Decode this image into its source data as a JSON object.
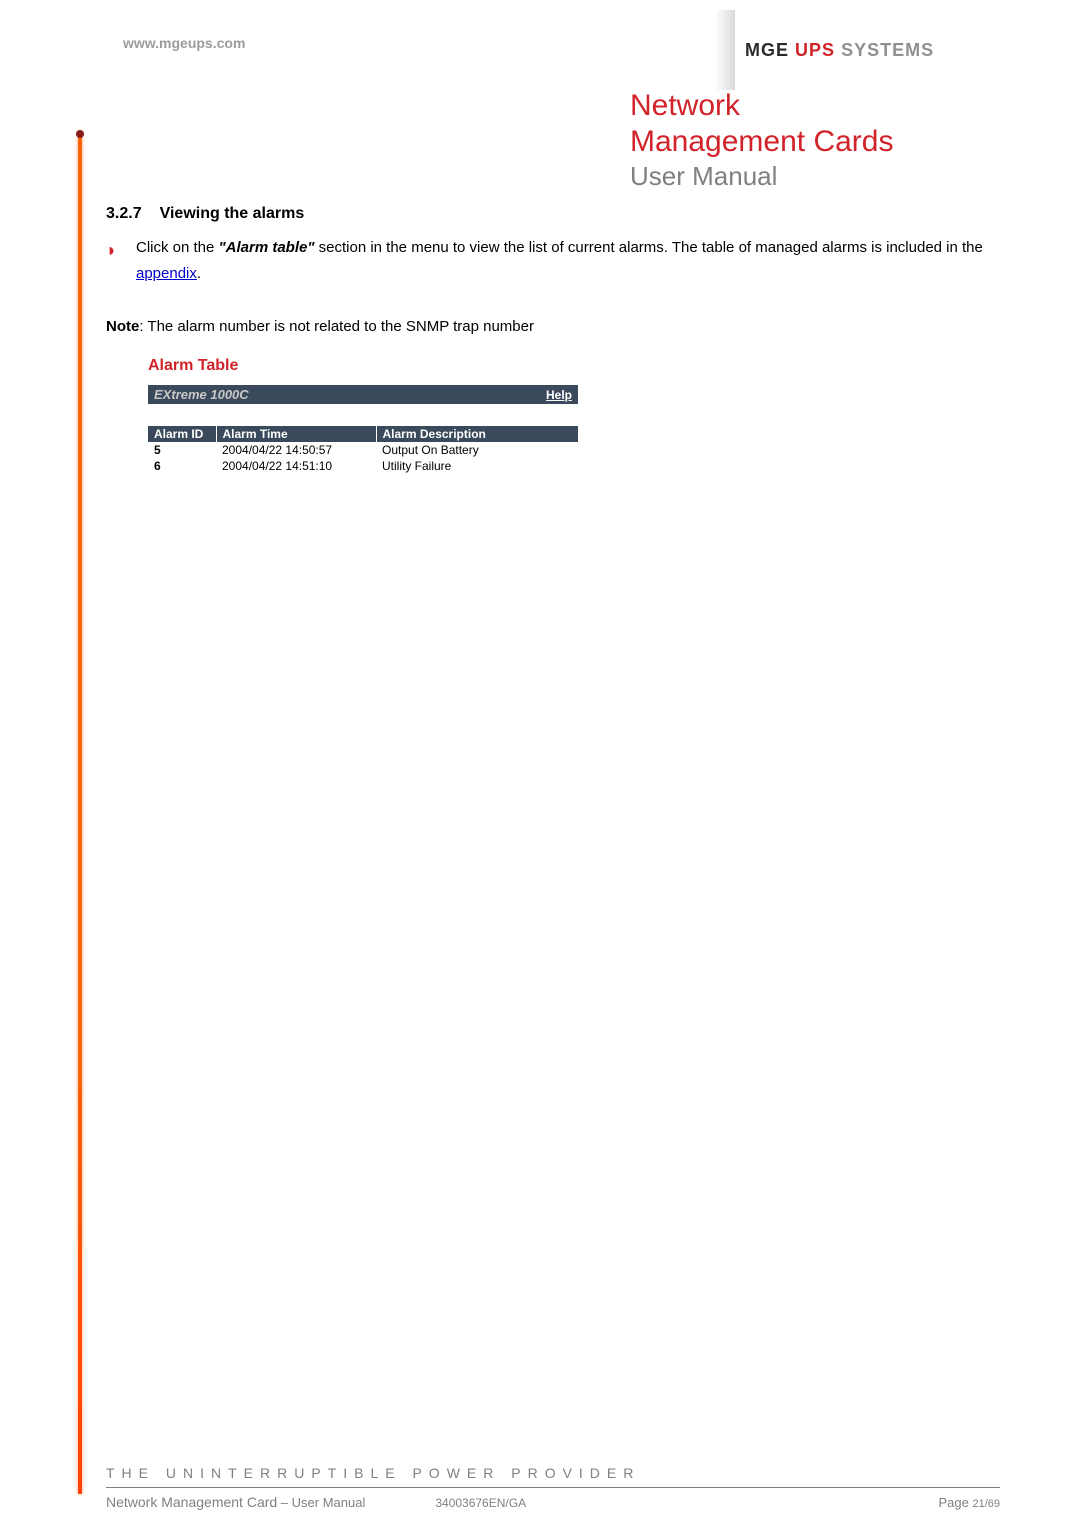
{
  "header": {
    "url": "www.mgeups.com",
    "logo": {
      "part1": "MGE",
      "part2": "UPS",
      "part3": "SYSTEMS"
    },
    "title_line1": "Network",
    "title_line2": "Management Cards",
    "subtitle": "User Manual"
  },
  "section": {
    "number": "3.2.7",
    "heading": "Viewing the alarms",
    "bullet_text_pre": "Click on the ",
    "bullet_text_bold": "\"Alarm table\"",
    "bullet_text_mid": " section in the menu to view the list of current alarms. The table of managed alarms is included in the ",
    "bullet_link": "appendix",
    "bullet_text_post": ".",
    "note_label": "Note",
    "note_text": ": The alarm number is not related to the SNMP trap number"
  },
  "alarm_panel": {
    "panel_title": "Alarm Table",
    "device": "EXtreme 1000C",
    "help": "Help",
    "columns": {
      "c1": "Alarm ID",
      "c2": "Alarm Time",
      "c3": "Alarm Description"
    },
    "rows": [
      {
        "id": "5",
        "time": "2004/04/22 14:50:57",
        "desc": "Output On Battery"
      },
      {
        "id": "6",
        "time": "2004/04/22 14:51:10",
        "desc": "Utility Failure"
      }
    ]
  },
  "footer": {
    "tagline": "THE UNINTERRUPTIBLE POWER PROVIDER",
    "doc_title": "Network Management Card",
    "doc_sub": " – User Manual",
    "doc_code": "34003676EN/GA",
    "page_label": "Page ",
    "page_num": "21/69"
  }
}
